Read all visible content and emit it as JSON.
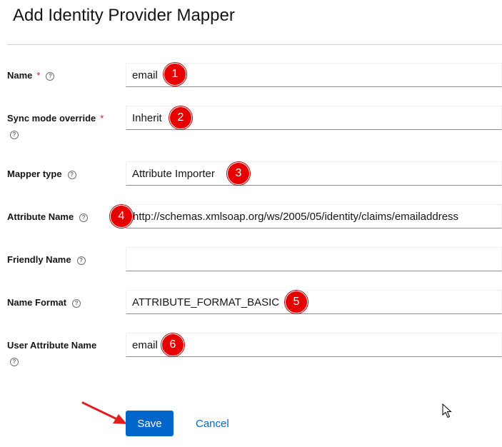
{
  "page": {
    "title": "Add Identity Provider Mapper"
  },
  "form": {
    "required_mark": "*",
    "help_glyph": "?",
    "fields": [
      {
        "label": "Name",
        "value": "email",
        "badge": "1"
      },
      {
        "label": "Sync mode override",
        "value": "Inherit",
        "badge": "2"
      },
      {
        "label": "Mapper type",
        "value": "Attribute Importer",
        "badge": "3"
      },
      {
        "label": "Attribute Name",
        "value": "http://schemas.xmlsoap.org/ws/2005/05/identity/claims/emailaddress",
        "badge": "4"
      },
      {
        "label": "Friendly Name",
        "value": ""
      },
      {
        "label": "Name Format",
        "value": "ATTRIBUTE_FORMAT_BASIC",
        "badge": "5"
      },
      {
        "label": "User Attribute Name",
        "value": "email",
        "badge": "6"
      }
    ]
  },
  "actions": {
    "save_label": "Save",
    "cancel_label": "Cancel"
  },
  "colors": {
    "primary": "#0066cc",
    "required": "#c9190b",
    "annotation": "#e60000"
  }
}
